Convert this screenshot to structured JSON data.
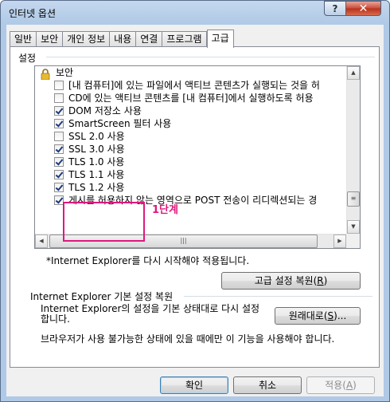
{
  "window": {
    "title": "인터넷 옵션",
    "help_label": "?",
    "close_label": "✕"
  },
  "tabs": [
    {
      "label": "일반"
    },
    {
      "label": "보안"
    },
    {
      "label": "개인 정보"
    },
    {
      "label": "내용"
    },
    {
      "label": "연결"
    },
    {
      "label": "프로그램"
    },
    {
      "label": "고급",
      "active": true
    }
  ],
  "settings": {
    "label": "설정",
    "group_header": "보안",
    "items": [
      {
        "label": "[내 컴퓨터]에 있는 파일에서 액티브 콘텐츠가 실행되는 것을 허",
        "checked": false
      },
      {
        "label": "CD에 있는 액티브 콘텐츠를 [내 컴퓨터]에서 실행하도록 허용",
        "checked": false
      },
      {
        "label": "DOM 저장소 사용",
        "checked": true
      },
      {
        "label": "SmartScreen 필터 사용",
        "checked": true
      },
      {
        "label": "SSL 2.0 사용",
        "checked": false
      },
      {
        "label": "SSL 3.0 사용",
        "checked": true
      },
      {
        "label": "TLS 1.0 사용",
        "checked": true
      },
      {
        "label": "TLS 1.1 사용",
        "checked": true
      },
      {
        "label": "TLS 1.2 사용",
        "checked": true
      },
      {
        "label": "게시를 허용하지 않는 영역으로 POST 전송이 리디렉션되는 경",
        "checked": true
      }
    ],
    "annotation": "1단계"
  },
  "restart_note": "*Internet Explorer를 다시 시작해야 적용됩니다.",
  "advanced_reset_button": {
    "label": "고급 설정 복원",
    "hotkey": "R"
  },
  "restore_group": {
    "label": "Internet Explorer 기본 설정 복원",
    "description": "Internet Explorer의 설정을 기본 상태대로 다시 설정합니다.",
    "button_label": "원래대로",
    "button_hotkey": "S",
    "warning": "브라우저가 사용 불가능한 상태에 있을 때에만 이 기능을 사용해야 합니다."
  },
  "dialog_buttons": {
    "ok": "확인",
    "cancel": "취소",
    "apply": "적용",
    "apply_hotkey": "A"
  }
}
